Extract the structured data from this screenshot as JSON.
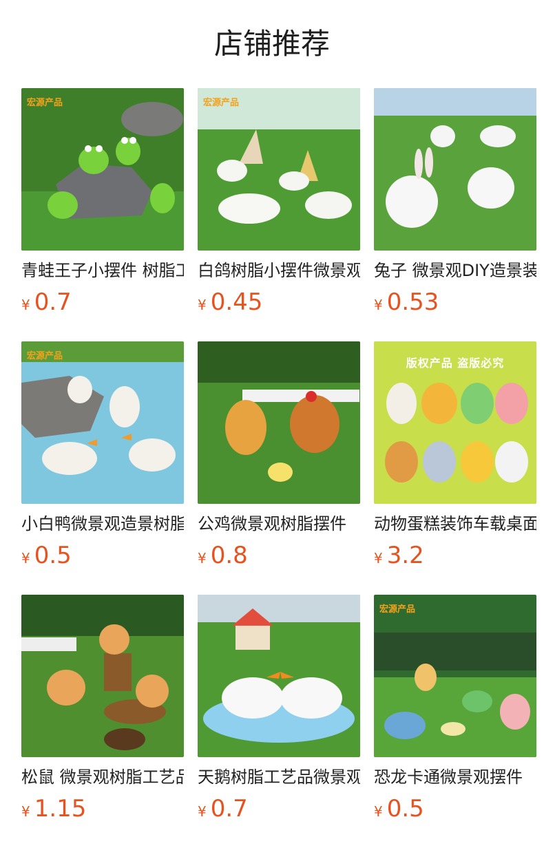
{
  "header": {
    "title": "店铺推荐"
  },
  "products": [
    {
      "title": "青蛙王子小摆件 树脂工艺品",
      "currency": "¥",
      "price": "0.7",
      "image": "frogs-on-rock",
      "brand": "宏源产品"
    },
    {
      "title": "白鸽树脂小摆件微景观",
      "currency": "¥",
      "price": "0.45",
      "image": "white-doves-windmill",
      "brand": "宏源产品"
    },
    {
      "title": "兔子 微景观DIY造景装饰",
      "currency": "¥",
      "price": "0.53",
      "image": "white-rabbits"
    },
    {
      "title": "小白鸭微景观造景树脂",
      "currency": "¥",
      "price": "0.5",
      "image": "white-ducks-pond",
      "brand": "宏源产品"
    },
    {
      "title": "公鸡微景观树脂摆件",
      "currency": "¥",
      "price": "0.8",
      "image": "roosters-fence"
    },
    {
      "title": "动物蛋糕装饰车载桌面摆件",
      "currency": "¥",
      "price": "3.2",
      "image": "cartoon-animals",
      "overlay": "版权产品  盗版必究"
    },
    {
      "title": "松鼠 微景观树脂工艺品",
      "currency": "¥",
      "price": "1.15",
      "image": "squirrels-stumps"
    },
    {
      "title": "天鹅树脂工艺品微景观",
      "currency": "¥",
      "price": "0.7",
      "image": "swans-house"
    },
    {
      "title": "恐龙卡通微景观摆件",
      "currency": "¥",
      "price": "0.5",
      "image": "dinosaurs",
      "brand": "宏源产品"
    }
  ]
}
